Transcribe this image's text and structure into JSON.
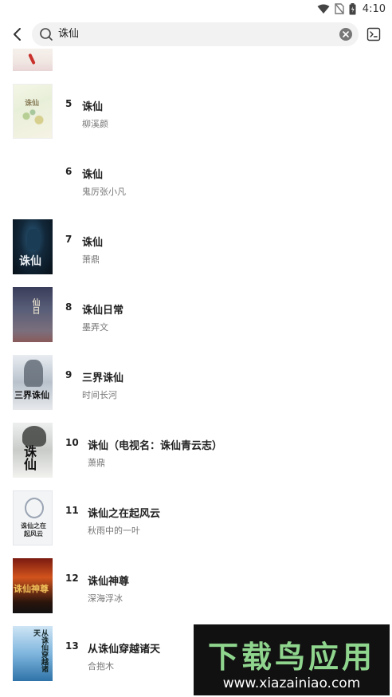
{
  "status_bar": {
    "time": "4:10",
    "icons": [
      "wifi-icon",
      "no-sim-icon",
      "battery-icon"
    ]
  },
  "search": {
    "query": "诛仙",
    "icons": {
      "back": "back-arrow-icon",
      "search": "search-icon",
      "clear": "clear-icon",
      "action": "terminal-icon"
    }
  },
  "results": [
    {
      "rank": "5",
      "title": "诛仙",
      "author": "柳溪颜"
    },
    {
      "rank": "6",
      "title": "诛仙",
      "author": "鬼厉张小凡"
    },
    {
      "rank": "7",
      "title": "诛仙",
      "author": "萧鼎"
    },
    {
      "rank": "8",
      "title": "诛仙日常",
      "author": "墨弄文"
    },
    {
      "rank": "9",
      "title": "三界诛仙",
      "author": "时间长河"
    },
    {
      "rank": "10",
      "title": "诛仙（电视名：诛仙青云志）",
      "author": "萧鼎"
    },
    {
      "rank": "11",
      "title": "诛仙之在起风云",
      "author": "秋雨中的一叶"
    },
    {
      "rank": "12",
      "title": "诛仙神尊",
      "author": "深海浮冰"
    },
    {
      "rank": "13",
      "title": "从诛仙穿越诸天",
      "author": "合抱木"
    }
  ],
  "covers": {
    "r5": "诛仙",
    "r7": "诛仙",
    "r8": "仙日",
    "r9": "三界诛仙",
    "r10": "诛仙",
    "r11": "诛仙之在起风云",
    "r12": "诛仙神尊",
    "r13": "从诛仙穿越诸天"
  },
  "watermark": {
    "logo": "下载鸟应用",
    "url": "www.xiazainiao.com"
  }
}
